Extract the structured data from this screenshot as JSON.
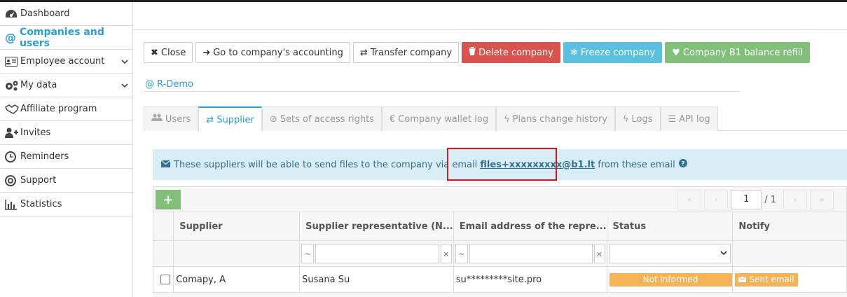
{
  "sidebar": {
    "items": [
      {
        "label": "Dashboard",
        "icon": "dashboard-icon"
      },
      {
        "label": "Companies and users",
        "icon": "at-icon",
        "active": true
      },
      {
        "label": "Employee account",
        "icon": "id-card-icon",
        "expandable": true
      },
      {
        "label": "My data",
        "icon": "gears-icon",
        "expandable": true
      },
      {
        "label": "Affiliate program",
        "icon": "handshake-icon"
      },
      {
        "label": "Invites",
        "icon": "user-plus-icon"
      },
      {
        "label": "Reminders",
        "icon": "clock-icon"
      },
      {
        "label": "Support",
        "icon": "life-ring-icon"
      },
      {
        "label": "Statistics",
        "icon": "bar-chart-icon"
      }
    ]
  },
  "toolbar": {
    "close": "Close",
    "accounting": "Go to company's accounting",
    "transfer": "Transfer company",
    "delete": "Delete company",
    "freeze": "Freeze company",
    "refill": "Company B1 balance refill"
  },
  "company": {
    "name": "R-Demo"
  },
  "tabs": [
    {
      "label": "Users"
    },
    {
      "label": "Supplier",
      "active": true
    },
    {
      "label": "Sets of access rights"
    },
    {
      "label": "Company wallet log"
    },
    {
      "label": "Plans change history"
    },
    {
      "label": "Logs"
    },
    {
      "label": "API log"
    }
  ],
  "info": {
    "text_before": "These suppliers will be able to send files to the company via email",
    "email": "files+xxxxxxxxx@b1.lt",
    "text_after": "from these email"
  },
  "pager": {
    "current": "1",
    "total": "/ 1"
  },
  "table": {
    "columns": [
      "Supplier",
      "Supplier representative (N...",
      "Email address of the repre...",
      "Status",
      "Notify"
    ],
    "filter_op": "~",
    "filter_clear": "×",
    "rows": [
      {
        "supplier": "Comapy, A",
        "representative": "Susana Su",
        "email": "su*********site.pro",
        "status": "Not informed",
        "notify": "Sent email"
      }
    ]
  },
  "colors": {
    "accent": "#2a9fd6",
    "danger": "#d9534f",
    "info": "#5bc0de",
    "success": "#81bf7b",
    "warning": "#f5b355",
    "highlight": "#d9161b"
  }
}
